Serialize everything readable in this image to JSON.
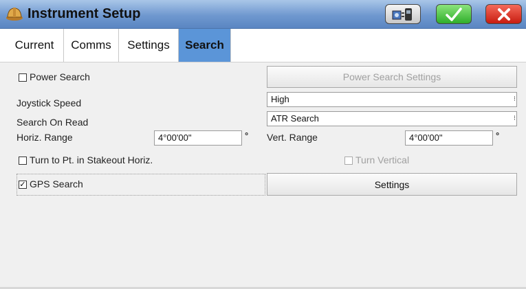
{
  "window": {
    "title": "Instrument Setup"
  },
  "tabs": [
    {
      "label": "Current",
      "active": false
    },
    {
      "label": "Comms",
      "active": false
    },
    {
      "label": "Settings",
      "active": false
    },
    {
      "label": "Search",
      "active": true
    }
  ],
  "search": {
    "power_search": {
      "label": "Power Search",
      "checked": false
    },
    "power_search_settings_button": "Power Search Settings",
    "joystick_speed": {
      "label": "Joystick Speed",
      "value": "High"
    },
    "search_on_read": {
      "label": "Search On Read",
      "value": "ATR Search"
    },
    "horiz_range": {
      "label": "Horiz. Range",
      "value": "4°00'00\"",
      "unit": "°"
    },
    "vert_range": {
      "label": "Vert. Range",
      "value": "4°00'00\"",
      "unit": "°"
    },
    "turn_to_point": {
      "label": "Turn to Pt. in Stakeout Horiz.",
      "checked": false
    },
    "turn_vertical": {
      "label": "Turn Vertical",
      "checked": false,
      "enabled": false
    },
    "gps_search": {
      "label": "GPS Search",
      "checked": true
    },
    "settings_button": "Settings"
  },
  "colors": {
    "title_bar": "#6f98cf",
    "active_tab": "#5b95d8",
    "ok_green": "#2fae2a",
    "close_red": "#c81c10"
  }
}
